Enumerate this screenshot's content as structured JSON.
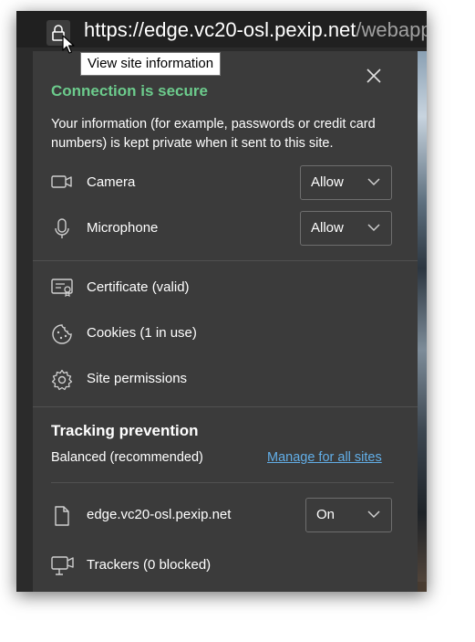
{
  "address_bar": {
    "url_host": "https://edge.vc20-osl.pexip.net",
    "url_path": "/webapp/"
  },
  "tooltip": {
    "text": "View site information"
  },
  "connection": {
    "title": "Connection is secure",
    "description": "Your information (for example, passwords or credit card numbers) is kept private when it sent to this site.",
    "title_color": "#6ccb8c"
  },
  "permissions": {
    "camera": {
      "label": "Camera",
      "value": "Allow"
    },
    "microphone": {
      "label": "Microphone",
      "value": "Allow"
    }
  },
  "links": {
    "certificate": "Certificate (valid)",
    "cookies": "Cookies (1 in use)",
    "site_permissions": "Site permissions"
  },
  "tracking": {
    "title": "Tracking prevention",
    "mode": "Balanced (recommended)",
    "manage_link": "Manage for all sites",
    "site": {
      "label": "edge.vc20-osl.pexip.net",
      "value": "On"
    },
    "trackers": "Trackers (0 blocked)"
  },
  "colors": {
    "panel_bg": "#3b3b3b",
    "link": "#62aee7",
    "secure_green": "#6ccb8c"
  }
}
